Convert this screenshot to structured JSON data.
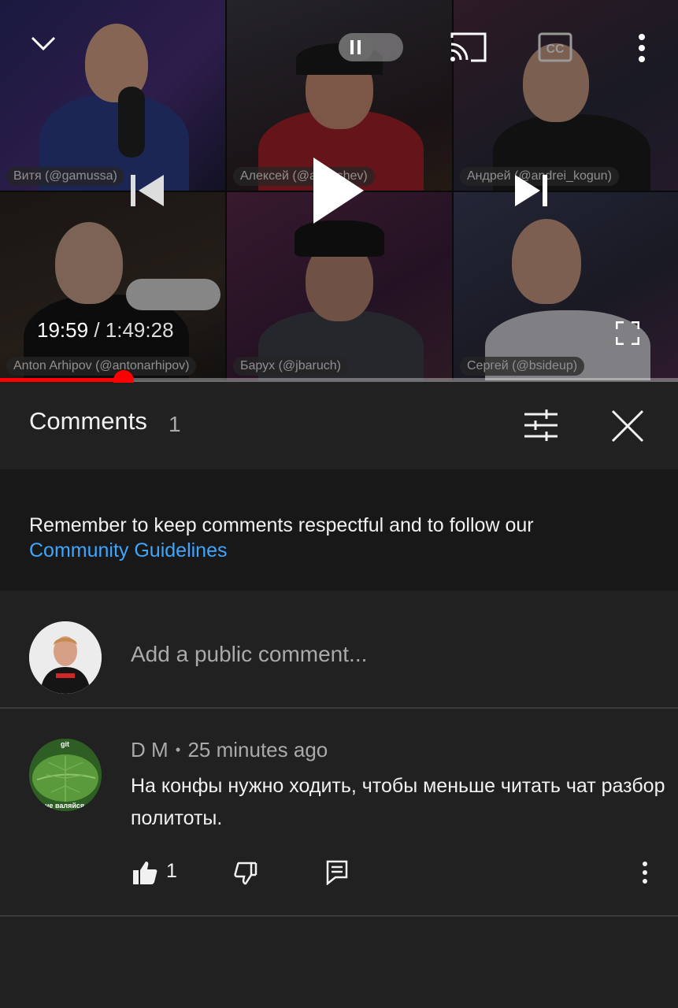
{
  "player": {
    "current_time": "19:59",
    "separator": "/",
    "duration": "1:49:28",
    "progress": 0.1826,
    "participants": [
      {
        "name": "Витя (@gamussa)"
      },
      {
        "name": "Алексей (@asheshev)"
      },
      {
        "name": "Андрей (@andrei_kogun)"
      },
      {
        "name": "Anton Arhipov (@antonarhipov)"
      },
      {
        "name": "Барух (@jbaruch)"
      },
      {
        "name": "Сергей (@bsideup)"
      }
    ],
    "icons": {
      "minimize": "chevron-down-icon",
      "autoplay": "pause-icon",
      "cast": "cast-icon",
      "captions": "cc-icon",
      "more": "more-vertical-icon",
      "previous": "skip-previous-icon",
      "play": "play-icon",
      "next": "skip-next-icon",
      "fullscreen": "fullscreen-icon"
    },
    "accent_color": "#ff0000"
  },
  "comments_panel": {
    "title": "Comments",
    "count": "1",
    "guidelines_text": "Remember to keep comments respectful and to follow our",
    "guidelines_link": "Community Guidelines",
    "link_color": "#3ea6ff",
    "composer_placeholder": "Add a public comment..."
  },
  "comments": [
    {
      "author": "D M",
      "bullet": "•",
      "time": "25 minutes ago",
      "text": "На конфы нужно ходить, чтобы меньше читать чат разбор политоты.",
      "likes": "1",
      "avatar_text_top": "git",
      "avatar_text_bottom": "не валяйся"
    }
  ]
}
